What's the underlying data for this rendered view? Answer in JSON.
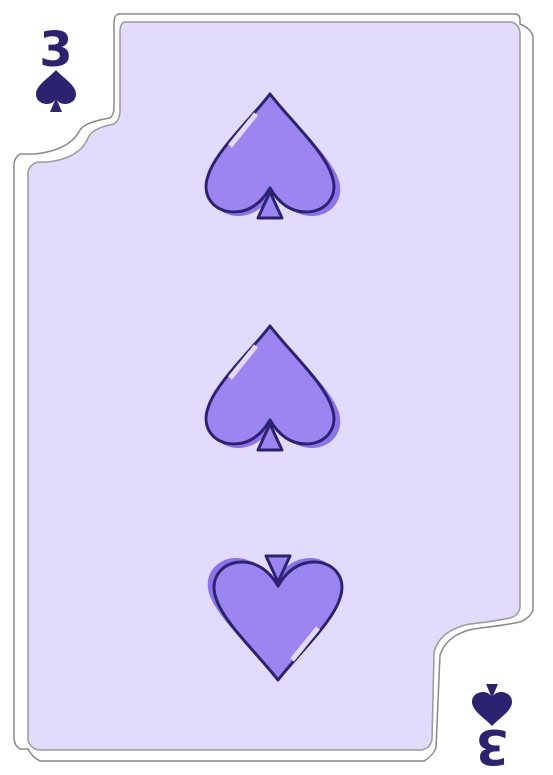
{
  "card": {
    "rank": "3",
    "suit": "spades",
    "pip_count": 3,
    "colors": {
      "background": "#ffffff",
      "card_fill": "#e3dbfd",
      "border": "#9a9a9a",
      "ink": "#2c2370",
      "pip_fill": "#9b85f0",
      "pip_shadow": "#8c73ec"
    },
    "icons": {
      "corner_suit": "spade-icon",
      "pip": "spade-icon"
    }
  }
}
